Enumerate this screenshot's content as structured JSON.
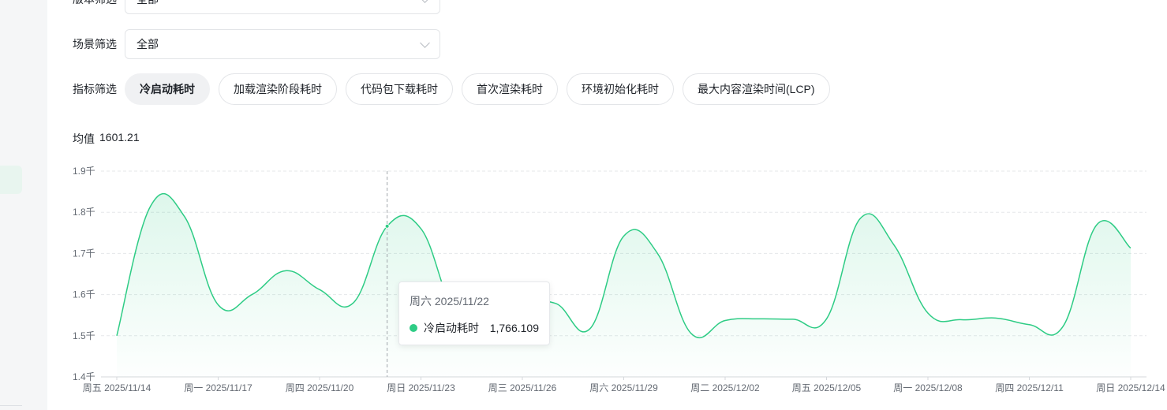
{
  "filters": {
    "version": {
      "label": "版本筛选",
      "value": "全部"
    },
    "scene": {
      "label": "场景筛选",
      "value": "全部"
    },
    "metric": {
      "label": "指标筛选",
      "options": [
        "冷启动耗时",
        "加载渲染阶段耗时",
        "代码包下载耗时",
        "首次渲染耗时",
        "环境初始化耗时",
        "最大内容渲染时间(LCP)"
      ],
      "selected": "冷启动耗时"
    }
  },
  "summary": {
    "label": "均值",
    "value": "1601.21"
  },
  "colors": {
    "line": "#2ecc85",
    "area_top": "#2ecc85",
    "grid": "#e5e7ea"
  },
  "chart_data": {
    "type": "area",
    "grid": true,
    "legend": "none",
    "ylim": [
      1400,
      1900
    ],
    "yticks": [
      1400,
      1500,
      1600,
      1700,
      1800,
      1900
    ],
    "ytick_labels": [
      "1.4千",
      "1.5千",
      "1.6千",
      "1.7千",
      "1.8千",
      "1.9千"
    ],
    "xtick_labels": [
      "周五 2025/11/14",
      "周一 2025/11/17",
      "周四 2025/11/20",
      "周日 2025/11/23",
      "周三 2025/11/26",
      "周六 2025/11/29",
      "周二 2025/12/02",
      "周五 2025/12/05",
      "周一 2025/12/08",
      "周四 2025/12/11",
      "周日 2025/12/14"
    ],
    "x_start": "2025-11-14",
    "x_end": "2025-12-14",
    "series": [
      {
        "name": "冷启动耗时",
        "x": [
          "2025-11-14",
          "2025-11-15",
          "2025-11-16",
          "2025-11-17",
          "2025-11-18",
          "2025-11-19",
          "2025-11-20",
          "2025-11-21",
          "2025-11-22",
          "2025-11-23",
          "2025-11-24",
          "2025-11-25",
          "2025-11-26",
          "2025-11-27",
          "2025-11-28",
          "2025-11-29",
          "2025-11-30",
          "2025-12-01",
          "2025-12-02",
          "2025-12-03",
          "2025-12-04",
          "2025-12-05",
          "2025-12-06",
          "2025-12-07",
          "2025-12-08",
          "2025-12-09",
          "2025-12-10",
          "2025-12-11",
          "2025-12-12",
          "2025-12-13",
          "2025-12-14"
        ],
        "values": [
          1500,
          1815,
          1790,
          1575,
          1600,
          1658,
          1612,
          1580,
          1766.109,
          1760,
          1560,
          1562,
          1578,
          1578,
          1517,
          1742,
          1700,
          1505,
          1537,
          1541,
          1540,
          1541,
          1785,
          1720,
          1555,
          1539,
          1543,
          1527,
          1523,
          1770,
          1713
        ]
      }
    ],
    "tooltip": {
      "date": "周六 2025/11/22",
      "series": "冷启动耗时",
      "value": "1,766.109"
    }
  }
}
